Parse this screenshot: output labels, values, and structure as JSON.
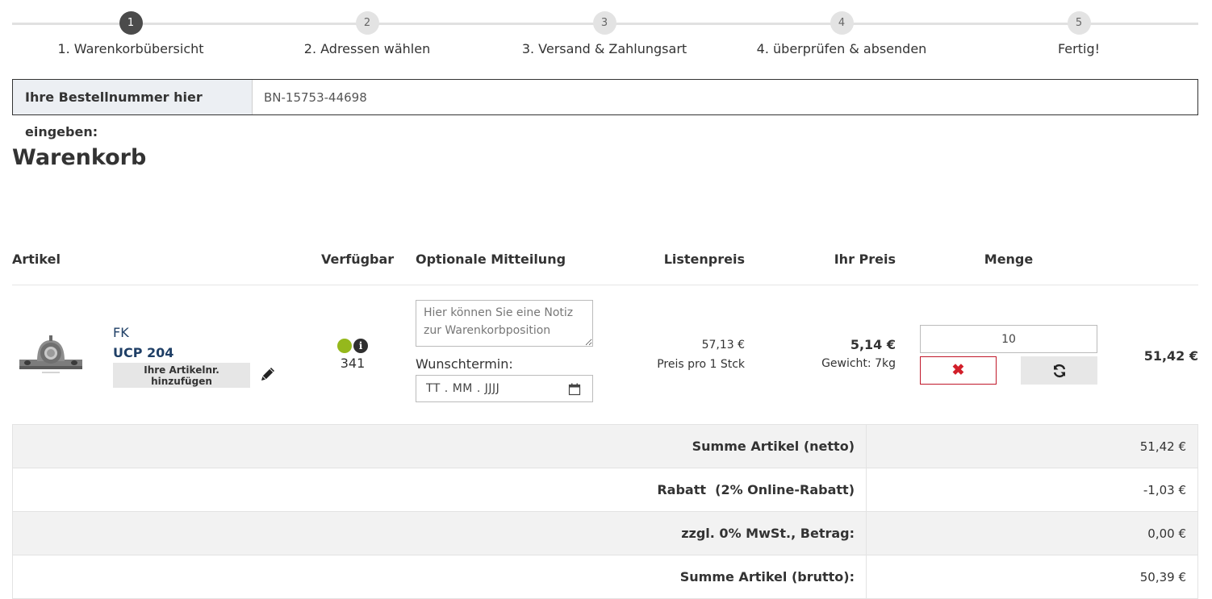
{
  "steps": [
    {
      "number": "1",
      "label": "1. Warenkorbübersicht",
      "active": true
    },
    {
      "number": "2",
      "label": "2. Adressen wählen",
      "active": false
    },
    {
      "number": "3",
      "label": "3. Versand & Zahlungsart",
      "active": false
    },
    {
      "number": "4",
      "label": "4. überprüfen & absenden",
      "active": false
    },
    {
      "number": "5",
      "label": "Fertig!",
      "active": false
    }
  ],
  "order_number": {
    "label": "Ihre Bestellnummer hier eingeben:",
    "value": "BN-15753-44698"
  },
  "page_title": "Warenkorb",
  "table_headers": {
    "article": "Artikel",
    "available": "Verfügbar",
    "message": "Optionale Mitteilung",
    "list_price": "Listenpreis",
    "your_price": "Ihr Preis",
    "quantity": "Menge"
  },
  "item": {
    "brand": "FK",
    "name": "UCP 204",
    "add_article_button": "Ihre Artikelnr. hinzufügen",
    "available_count": "341",
    "availability_color": "#95b81c",
    "note_placeholder": "Hier können Sie eine Notiz zur Warenkorbposition",
    "wunschtermin_label": "Wunschtermin:",
    "date_placeholder": "TT . MM . JJJJ",
    "list_price": "57,13 €",
    "price_unit": "Preis pro 1 Stck",
    "your_price": "5,14 €",
    "weight": "Gewicht: 7kg",
    "quantity": "10",
    "line_total": "51,42 €"
  },
  "summary": [
    {
      "label": "Summe Artikel (netto)",
      "value": "51,42 €"
    },
    {
      "label": "Rabatt  (2% Online-Rabatt)",
      "value": "-1,03 €"
    },
    {
      "label": "zzgl. 0% MwSt., Betrag:",
      "value": "0,00 €"
    },
    {
      "label": "Summe Artikel (brutto):",
      "value": "50,39 €"
    }
  ],
  "icons": {
    "edit": "pencil-icon",
    "info": "info-icon",
    "calendar": "calendar-icon",
    "delete": "close-icon",
    "refresh": "refresh-icon"
  },
  "colors": {
    "accent_dark": "#4b4b4b",
    "product_link": "#1f3f66",
    "delete_red": "#d21f2a",
    "available_green": "#95b81c"
  }
}
